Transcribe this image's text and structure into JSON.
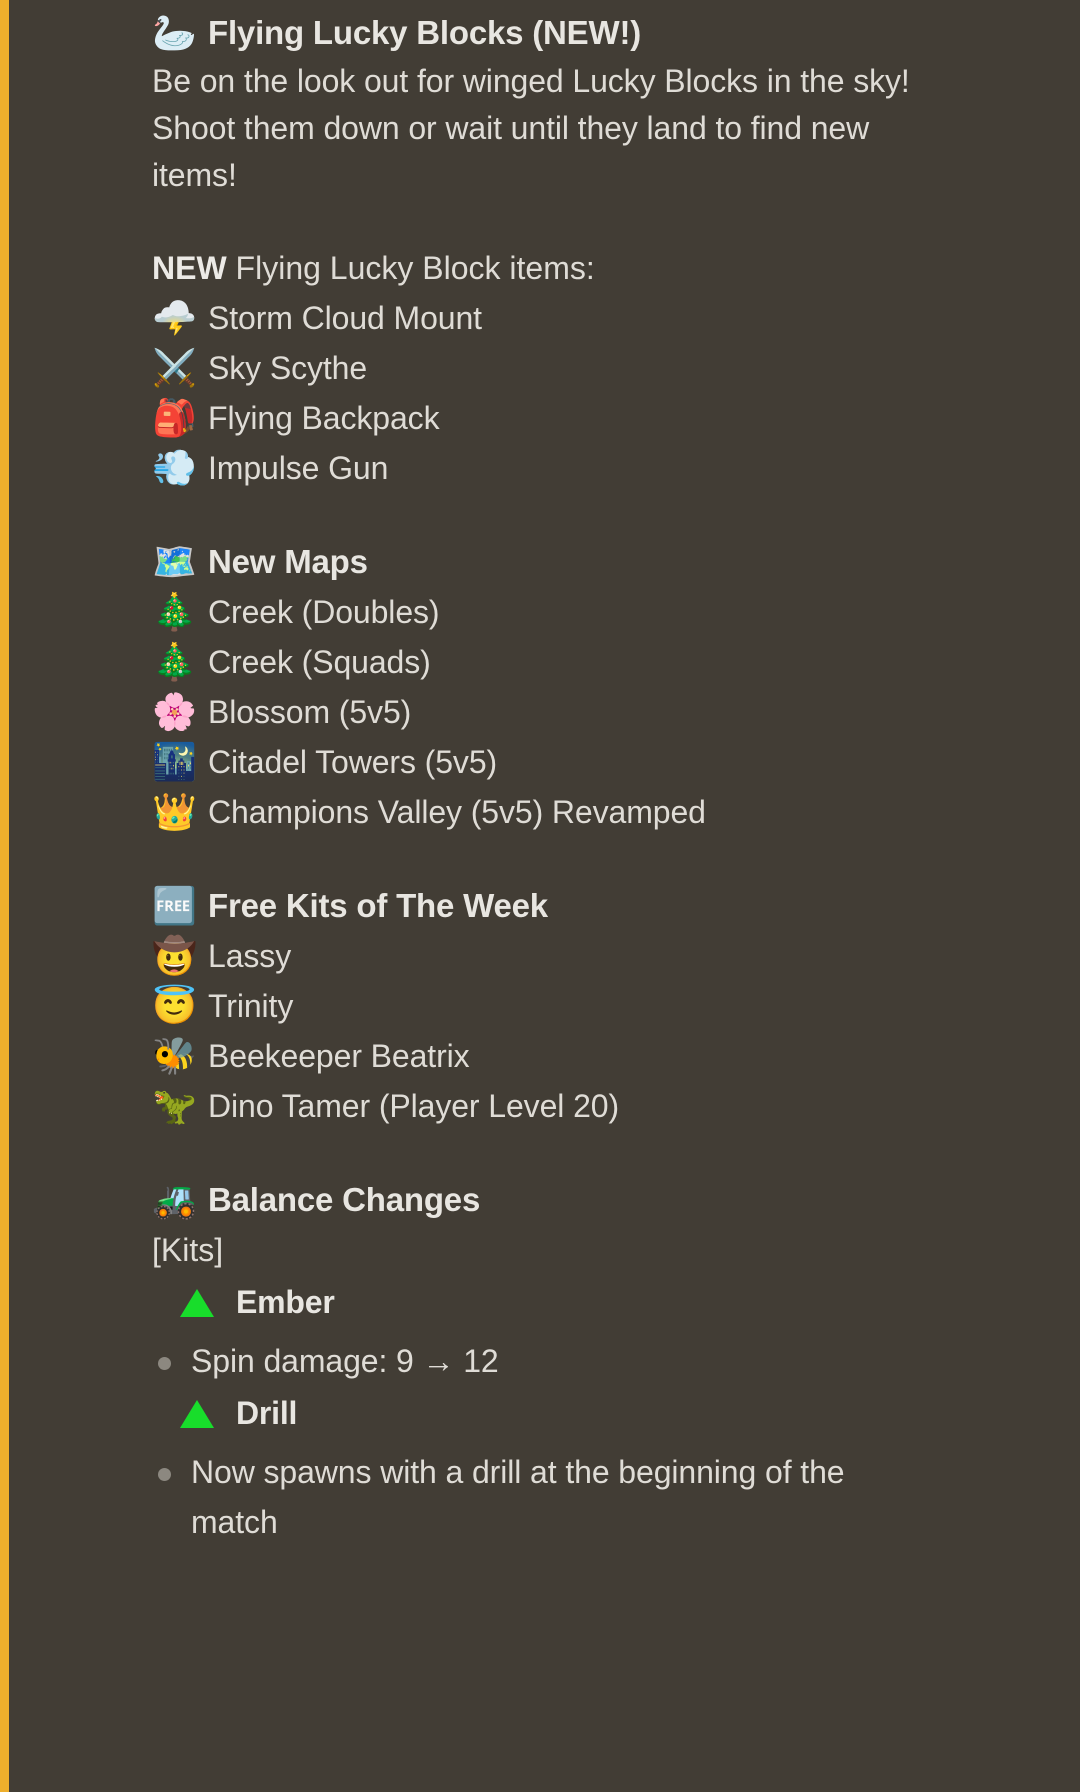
{
  "accent_color": "#eeaf2c",
  "background_color": "#423d35",
  "buff_color": "#18dd2b",
  "sections": {
    "flying_lucky_blocks": {
      "emoji": "🦢",
      "emoji_name": "swan-emoji",
      "title": "Flying Lucky Blocks (NEW!)",
      "body": "Be on the look out for winged Lucky Blocks in the sky! Shoot them down or wait until they land to find new items!",
      "items_label_strong": "NEW",
      "items_label_rest": " Flying Lucky Block items:",
      "items": [
        {
          "emoji": "🌩️",
          "emoji_name": "storm-cloud-emoji",
          "label": "Storm Cloud Mount"
        },
        {
          "emoji": "⚔️",
          "emoji_name": "crossed-swords-emoji",
          "label": "Sky Scythe"
        },
        {
          "emoji": "🎒",
          "emoji_name": "backpack-emoji",
          "label": "Flying Backpack"
        },
        {
          "emoji": "💨",
          "emoji_name": "dash-emoji",
          "label": "Impulse Gun"
        }
      ]
    },
    "new_maps": {
      "emoji": "🗺️",
      "emoji_name": "world-map-emoji",
      "title": "New Maps",
      "items": [
        {
          "emoji": "🎄",
          "emoji_name": "evergreen-tree-emoji",
          "label": "Creek (Doubles)"
        },
        {
          "emoji": "🎄",
          "emoji_name": "evergreen-tree-emoji",
          "label": "Creek (Squads)"
        },
        {
          "emoji": "🌸",
          "emoji_name": "cherry-blossom-emoji",
          "label": "Blossom (5v5)"
        },
        {
          "emoji": "🌃",
          "emoji_name": "night-city-emoji",
          "label": "Citadel Towers (5v5)"
        },
        {
          "emoji": "👑",
          "emoji_name": "crown-emoji",
          "label": "Champions Valley (5v5) Revamped"
        }
      ]
    },
    "free_kits": {
      "emoji": "🆓",
      "emoji_name": "free-button-emoji",
      "title": "Free Kits of The Week",
      "items": [
        {
          "emoji": "🤠",
          "emoji_name": "cowboy-face-emoji",
          "label": "Lassy"
        },
        {
          "emoji": "😇",
          "emoji_name": "angel-face-emoji",
          "label": "Trinity"
        },
        {
          "emoji": "🐝",
          "emoji_name": "honeybee-emoji",
          "label": "Beekeeper Beatrix"
        },
        {
          "emoji": "🦖",
          "emoji_name": "t-rex-emoji",
          "label": "Dino Tamer (Player Level 20)"
        }
      ]
    },
    "balance_changes": {
      "emoji": "🚜",
      "emoji_name": "tractor-emoji",
      "title": "Balance Changes",
      "category": "[Kits]",
      "kits": [
        {
          "marker": "buff-triangle",
          "name": "Ember",
          "changes": [
            "Spin damage: 9 → 12"
          ]
        },
        {
          "marker": "buff-triangle",
          "name": "Drill",
          "changes": [
            "Now spawns with a drill at the beginning of the match"
          ]
        }
      ]
    }
  }
}
